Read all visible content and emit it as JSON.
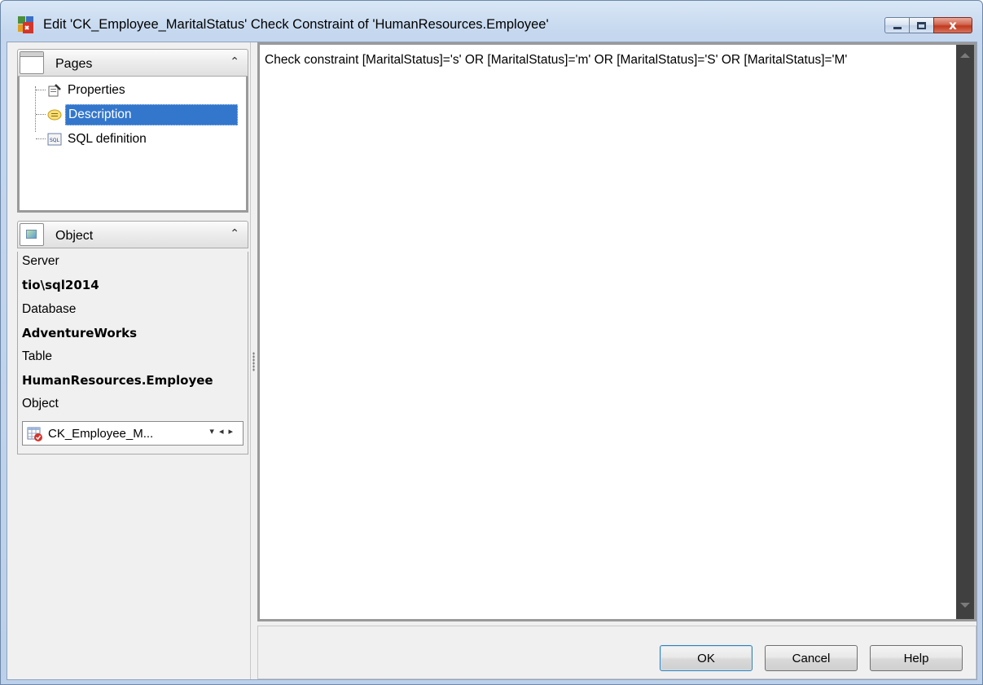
{
  "window": {
    "title": "Edit 'CK_Employee_MaritalStatus' Check Constraint of 'HumanResources.Employee'",
    "close_glyph": "x"
  },
  "pages_panel": {
    "header": "Pages",
    "items": [
      {
        "label": "Properties",
        "icon": "properties-icon",
        "selected": false
      },
      {
        "label": "Description",
        "icon": "description-icon",
        "selected": true
      },
      {
        "label": "SQL definition",
        "icon": "sql-icon",
        "selected": false
      }
    ]
  },
  "object_panel": {
    "header": "Object",
    "server_label": "Server",
    "server_value": "tio\\sql2014",
    "database_label": "Database",
    "database_value": "AdventureWorks",
    "table_label": "Table",
    "table_value": "HumanResources.Employee",
    "object_label": "Object",
    "object_value": "CK_Employee_M..."
  },
  "editor": {
    "text": "Check constraint [MaritalStatus]='s' OR [MaritalStatus]='m' OR [MaritalStatus]='S' OR [MaritalStatus]='M'"
  },
  "buttons": {
    "ok": "OK",
    "cancel": "Cancel",
    "help": "Help"
  },
  "colors": {
    "selection": "#3377cc",
    "scrollbar": "#404040",
    "close_button": "#c0391f"
  }
}
